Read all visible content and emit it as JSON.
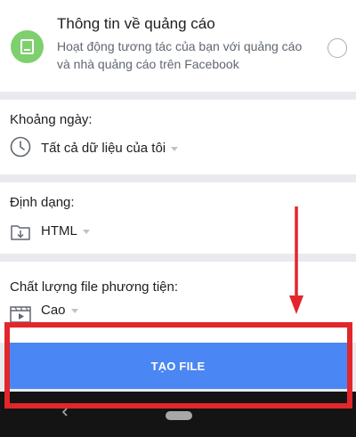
{
  "ads_section": {
    "title": "Thông tin về quảng cáo",
    "description": "Hoạt động tương tác của bạn với quảng cáo và nhà quảng cáo trên Facebook",
    "icon": "tablet-icon",
    "selected": false
  },
  "date_range": {
    "label": "Khoảng ngày:",
    "value": "Tất cả dữ liệu của tôi",
    "icon": "clock-icon"
  },
  "format": {
    "label": "Định dạng:",
    "value": "HTML",
    "icon": "folder-download-icon"
  },
  "media_quality": {
    "label": "Chất lượng file phương tiện:",
    "value": "Cao",
    "icon": "film-icon"
  },
  "create_button": {
    "label": "TẠO FILE"
  },
  "navbar": {
    "back_icon": "chevron-left-icon",
    "home_icon": "home-pill-icon"
  },
  "annotations": {
    "highlight_color": "#e2262b",
    "arrow_color": "#e2262b"
  },
  "colors": {
    "button": "#4a86f4",
    "ads_icon_bg": "#7ed06e",
    "page_bg": "#e9eaee"
  }
}
